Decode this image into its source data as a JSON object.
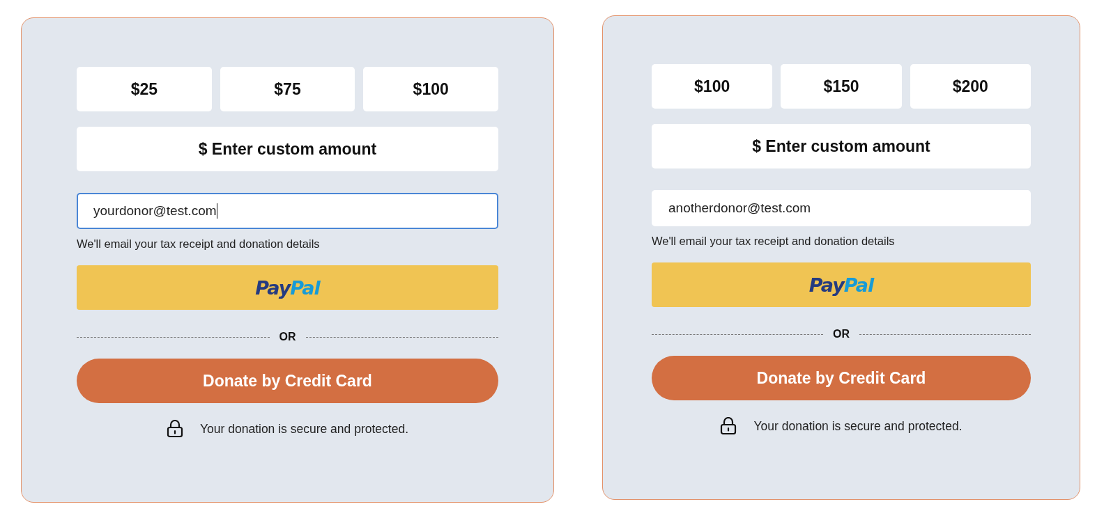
{
  "forms": [
    {
      "amounts": [
        {
          "label": "$25",
          "selected": false
        },
        {
          "label": "$75",
          "selected": false
        },
        {
          "label": "$100",
          "selected": false
        }
      ],
      "custom_amount": {
        "placeholder": "$ Enter custom amount"
      },
      "email": {
        "value": "yourdonor@test.com",
        "focused": true
      },
      "email_hint": "We'll email your tax receipt and donation details",
      "paypal": {
        "pay": "Pay",
        "pal": "Pal"
      },
      "separator": "OR",
      "donate_button": "Donate by Credit Card",
      "secure_note": "Your donation is secure and protected."
    },
    {
      "amounts": [
        {
          "label": "$100",
          "selected": false
        },
        {
          "label": "$150",
          "selected": false
        },
        {
          "label": "$200",
          "selected": false
        }
      ],
      "custom_amount": {
        "placeholder": "$ Enter custom amount"
      },
      "email": {
        "value": "anotherdonor@test.com",
        "focused": false
      },
      "email_hint": "We'll email your tax receipt and donation details",
      "paypal": {
        "pay": "Pay",
        "pal": "Pal"
      },
      "separator": "OR",
      "donate_button": "Donate by Credit Card",
      "secure_note": "Your donation is secure and protected."
    }
  ]
}
